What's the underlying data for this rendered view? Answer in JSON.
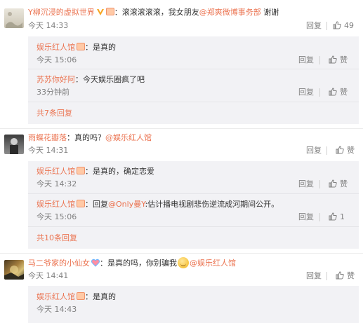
{
  "comments": [
    {
      "username": "Y柳沉浸的虚拟世界",
      "text": "：滚滚滚滚滚，我女朋友",
      "mention": "@郑爽微博事务部",
      "tail": " 谢谢",
      "time": "今天 14:33",
      "reply_label": "回复",
      "like_count": "49"
    },
    {
      "username": "雨蝶花瓣落",
      "text": "：真的吗？",
      "mention": "@娱乐红人馆",
      "time": "今天 14:31",
      "reply_label": "回复",
      "like_label": "赞"
    },
    {
      "username": "马二爷家的小仙女",
      "text": "：是真的吗，你别骗我",
      "mention": "@娱乐红人馆",
      "time": "今天 14:41",
      "reply_label": "回复",
      "like_label": "赞"
    }
  ],
  "replies": [
    {
      "username": "娱乐红人馆",
      "text": "：是真的",
      "time": "今天 15:06",
      "reply_label": "回复",
      "like_label": "赞"
    },
    {
      "username": "苏苏你好阿",
      "text": "：今天娱乐圈疯了吧",
      "time": "33分钟前",
      "reply_label": "回复",
      "like_label": "赞"
    },
    {
      "username": "娱乐红人馆",
      "text": "：是真的，确定恋爱",
      "time": "今天 14:32",
      "reply_label": "回复",
      "like_label": "赞"
    },
    {
      "username": "娱乐红人馆",
      "text_prefix": "：回复",
      "mention": "@Only曼Y",
      "text": ":估计播电视剧悲伤逆流成河期间公开。",
      "time": "今天 15:06",
      "reply_label": "回复",
      "like_count": "1"
    },
    {
      "username": "娱乐红人馆",
      "text": "：是真的",
      "time": "今天 14:43"
    }
  ],
  "more_links": [
    "共7条回复",
    "共10条回复"
  ],
  "colors": {
    "link": "#eb7350",
    "muted": "#808080",
    "reply_bg": "#f2f2f5"
  },
  "icons": [
    "thumb-up-icon",
    "vip-v-icon",
    "member-badge-icon",
    "smile-emoji-icon",
    "rainbow-heart-icon"
  ]
}
